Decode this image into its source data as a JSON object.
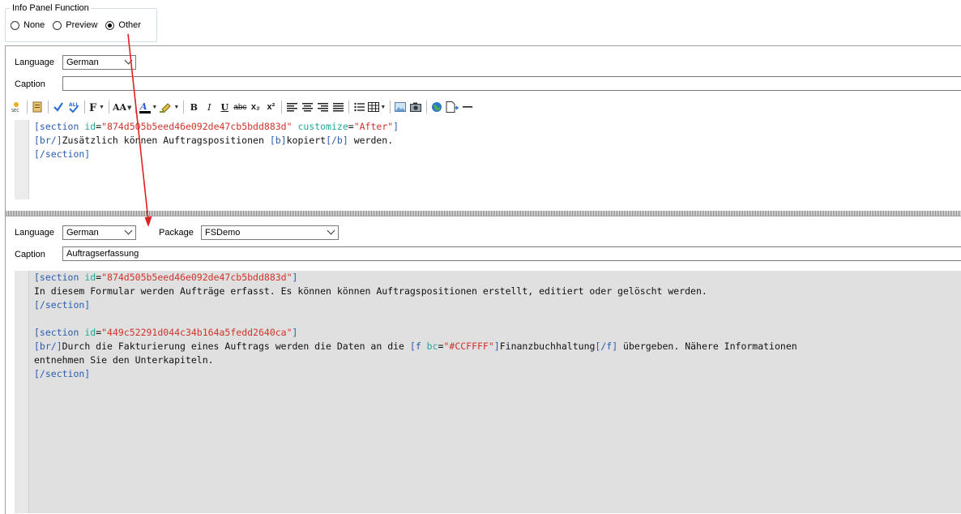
{
  "info_panel": {
    "legend": "Info Panel Function",
    "options": [
      "None",
      "Preview",
      "Other"
    ],
    "selected": "Other"
  },
  "top_panel": {
    "language_label": "Language",
    "language_value": "German",
    "caption_label": "Caption",
    "caption_value": "",
    "code_lines": [
      [
        {
          "t": "tag",
          "v": "[section "
        },
        {
          "t": "attr",
          "v": "id"
        },
        {
          "t": "eq",
          "v": "="
        },
        {
          "t": "str",
          "v": "\"874d505b5eed46e092de47cb5bdd883d\""
        },
        {
          "t": "attr",
          "v": " customize"
        },
        {
          "t": "eq",
          "v": "="
        },
        {
          "t": "str",
          "v": "\"After\""
        },
        {
          "t": "tag",
          "v": "]"
        }
      ],
      [
        {
          "t": "tag",
          "v": "[br/]"
        },
        {
          "t": "text",
          "v": "Zusätzlich können Auftragspositionen "
        },
        {
          "t": "tag",
          "v": "[b]"
        },
        {
          "t": "text",
          "v": "kopiert"
        },
        {
          "t": "tag",
          "v": "[/b]"
        },
        {
          "t": "text",
          "v": " werden."
        }
      ],
      [
        {
          "t": "tag",
          "v": "[/section]"
        }
      ]
    ]
  },
  "toolbar": {
    "buttons": [
      "insert-section",
      "page",
      "spell-check",
      "check-all",
      "format",
      "font-size",
      "font-color",
      "highlight-color",
      "bold",
      "italic",
      "underline",
      "strikethrough",
      "subscript",
      "superscript",
      "align-left",
      "align-center",
      "align-right",
      "justify",
      "list",
      "table",
      "image",
      "screenshot",
      "web-link",
      "insert-document",
      "horizontal-rule"
    ],
    "labels": {
      "bold": "B",
      "italic": "I",
      "underline": "U",
      "strike": "abc",
      "sub": "x₂",
      "sup": "x²",
      "font_size": "AA"
    }
  },
  "bottom_panel": {
    "language_label": "Language",
    "language_value": "German",
    "package_label": "Package",
    "package_value": "FSDemo",
    "caption_label": "Caption",
    "caption_value": "Auftragserfassung",
    "code_lines": [
      [
        {
          "t": "tag",
          "v": "[section "
        },
        {
          "t": "attr",
          "v": "id"
        },
        {
          "t": "eq",
          "v": "="
        },
        {
          "t": "str",
          "v": "\"874d505b5eed46e092de47cb5bdd883d\""
        },
        {
          "t": "tag",
          "v": "]"
        }
      ],
      [
        {
          "t": "text",
          "v": "In diesem Formular werden Aufträge erfasst. Es können können Auftragspositionen erstellt, editiert oder gelöscht werden."
        }
      ],
      [
        {
          "t": "tag",
          "v": "[/section]"
        }
      ],
      [],
      [
        {
          "t": "tag",
          "v": "[section "
        },
        {
          "t": "attr",
          "v": "id"
        },
        {
          "t": "eq",
          "v": "="
        },
        {
          "t": "str",
          "v": "\"449c52291d044c34b164a5fedd2640ca\""
        },
        {
          "t": "tag",
          "v": "]"
        }
      ],
      [
        {
          "t": "tag",
          "v": "[br/]"
        },
        {
          "t": "text",
          "v": "Durch die Fakturierung eines Auftrags werden die Daten an die "
        },
        {
          "t": "tag",
          "v": "[f "
        },
        {
          "t": "attr",
          "v": "bc"
        },
        {
          "t": "eq",
          "v": "="
        },
        {
          "t": "str",
          "v": "\"#CCFFFF\""
        },
        {
          "t": "tag",
          "v": "]"
        },
        {
          "t": "text",
          "v": "Finanzbuchhaltung"
        },
        {
          "t": "tag",
          "v": "[/f]"
        },
        {
          "t": "text",
          "v": " übergeben. Nähere Informationen"
        }
      ],
      [
        {
          "t": "text",
          "v": "entnehmen Sie den Unterkapiteln."
        }
      ],
      [
        {
          "t": "tag",
          "v": "[/section]"
        }
      ]
    ]
  },
  "colors": {
    "tag": "#2a5db0",
    "attr": "#26a69a",
    "string": "#d0332b",
    "annotation_arrow": "#e02020"
  }
}
